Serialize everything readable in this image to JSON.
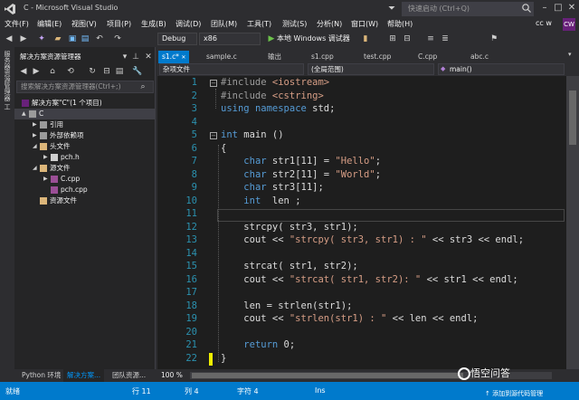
{
  "window": {
    "title": "C - Microsoft Visual Studio",
    "quick_launch_placeholder": "快速启动 (Ctrl+Q)",
    "user": "cc w",
    "user_badge": "CW"
  },
  "menu": {
    "items": [
      "文件(F)",
      "编辑(E)",
      "视图(V)",
      "项目(P)",
      "生成(B)",
      "调试(D)",
      "团队(M)",
      "工具(T)",
      "测试(S)",
      "分析(N)",
      "窗口(W)",
      "帮助(H)"
    ]
  },
  "toolbar": {
    "config": "Debug",
    "platform": "x86",
    "run_label": "本地 Windows 调试器"
  },
  "side_strip": {
    "label": "服务器资源管理器 工具箱"
  },
  "solution_explorer": {
    "title": "解决方案资源管理器",
    "search_placeholder": "搜索解决方案资源管理器(Ctrl+;)",
    "tree": [
      {
        "label": "解决方案\"C\"(1 个项目)",
        "level": 0,
        "arrow": ""
      },
      {
        "label": "C",
        "level": 0,
        "arrow": "▲"
      },
      {
        "label": "引用",
        "level": 1,
        "arrow": "▶"
      },
      {
        "label": "外部依赖项",
        "level": 1,
        "arrow": "▶"
      },
      {
        "label": "头文件",
        "level": 1,
        "arrow": "◢"
      },
      {
        "label": "pch.h",
        "level": 2,
        "arrow": "▶"
      },
      {
        "label": "源文件",
        "level": 1,
        "arrow": "◢"
      },
      {
        "label": "C.cpp",
        "level": 2,
        "arrow": "▶"
      },
      {
        "label": "pch.cpp",
        "level": 2,
        "arrow": ""
      },
      {
        "label": "资源文件",
        "level": 1,
        "arrow": ""
      }
    ]
  },
  "bottom_tabs": [
    "Python 环境",
    "解决方案...",
    "团队资源..."
  ],
  "editor": {
    "tabs": [
      "s1.c*",
      "sample.c",
      "输出",
      "s1.cpp",
      "test.cpp",
      "C.cpp",
      "abc.c"
    ],
    "nav_project": "杂项文件",
    "nav_scope": "(全局范围)",
    "nav_member": "main()",
    "zoom": "100 %",
    "lines": [
      {
        "n": "1",
        "html": "<span class=\"pp\">#include</span> <span class=\"inc\">&lt;iostream&gt;</span>"
      },
      {
        "n": "2",
        "html": "<span class=\"pp\">#include</span> <span class=\"inc\">&lt;cstring&gt;</span>"
      },
      {
        "n": "3",
        "html": "<span class=\"kw\">using</span> <span class=\"kw\">namespace</span> std;"
      },
      {
        "n": "4",
        "html": ""
      },
      {
        "n": "5",
        "html": "<span class=\"kw\">int</span> main ()"
      },
      {
        "n": "6",
        "html": "{"
      },
      {
        "n": "7",
        "html": "    <span class=\"kw\">char</span> str1[11] = <span class=\"str\">\"Hello\"</span>;"
      },
      {
        "n": "8",
        "html": "    <span class=\"kw\">char</span> str2[11] = <span class=\"str\">\"World\"</span>;"
      },
      {
        "n": "9",
        "html": "    <span class=\"kw\">char</span> str3[11];"
      },
      {
        "n": "10",
        "html": "    <span class=\"kw\">int</span>  len ;"
      },
      {
        "n": "11",
        "html": ""
      },
      {
        "n": "12",
        "html": "    strcpy( str3, str1);"
      },
      {
        "n": "13",
        "html": "    cout &lt;&lt; <span class=\"str\">\"strcpy( str3, str1) : \"</span> &lt;&lt; str3 &lt;&lt; endl;"
      },
      {
        "n": "14",
        "html": ""
      },
      {
        "n": "15",
        "html": "    strcat( str1, str2);"
      },
      {
        "n": "16",
        "html": "    cout &lt;&lt; <span class=\"str\">\"strcat( str1, str2): \"</span> &lt;&lt; str1 &lt;&lt; endl;"
      },
      {
        "n": "17",
        "html": ""
      },
      {
        "n": "18",
        "html": "    len = strlen(str1);"
      },
      {
        "n": "19",
        "html": "    cout &lt;&lt; <span class=\"str\">\"strlen(str1) : \"</span> &lt;&lt; len &lt;&lt; endl;"
      },
      {
        "n": "20",
        "html": ""
      },
      {
        "n": "21",
        "html": "    <span class=\"kw\">return</span> 0;"
      },
      {
        "n": "22",
        "html": "}"
      }
    ]
  },
  "status": {
    "ready": "就绪",
    "row": "行 11",
    "col": "列 4",
    "char": "字符 4",
    "ins": "Ins",
    "source_control": "添加到源代码管理"
  },
  "watermark": "悟空问答",
  "colors": {
    "accent": "#007acc",
    "keyword": "#569cd6",
    "string": "#d69d85",
    "line_number": "#2b91af"
  }
}
